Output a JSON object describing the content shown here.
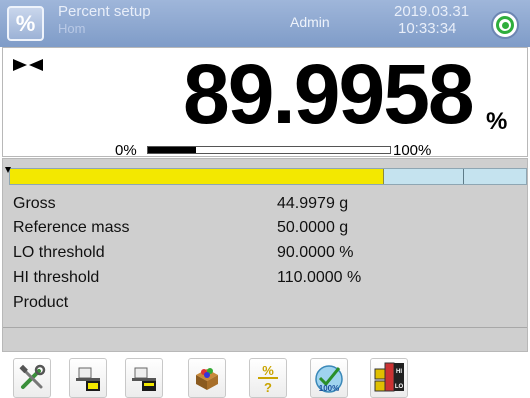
{
  "header": {
    "mode_icon": "percent-icon",
    "mode_icon_glyph": "%",
    "mode_title": "Percent setup",
    "mode_subtitle": "Hom",
    "user": "Admin",
    "date": "2019.03.31",
    "time": "10:33:34",
    "status_icon": "status-ok-icon"
  },
  "display": {
    "stability_icon": "stable-indicator-icon",
    "value": "89.9958",
    "unit": "%",
    "range_min_label": "0%",
    "range_max_label": "100%",
    "range_fill_fraction": 0.2
  },
  "threshold_bar": {
    "fill_fraction": 0.725,
    "hi_mark_fraction": 0.877
  },
  "info": {
    "rows": [
      {
        "label": "Gross",
        "value": "44.9979 g"
      },
      {
        "label": "Reference mass",
        "value": "50.0000 g"
      },
      {
        "label": "LO threshold",
        "value": "90.0000 %"
      },
      {
        "label": "HI threshold",
        "value": "110.0000 %"
      },
      {
        "label": "Product",
        "value": ""
      }
    ]
  },
  "toolbar": {
    "buttons": [
      {
        "icon": "settings-tools-icon"
      },
      {
        "icon": "tare-icon"
      },
      {
        "icon": "zero-icon"
      },
      {
        "icon": "product-database-icon"
      },
      {
        "icon": "percent-reference-icon",
        "glyph_top": "%",
        "glyph_bottom": "?"
      },
      {
        "icon": "reference-100-icon",
        "glyph": "100%"
      },
      {
        "icon": "hi-lo-thresholds-icon",
        "glyph_top": "HI",
        "glyph_bottom": "LO"
      }
    ]
  },
  "colors": {
    "header_bg": "#8ea8d2",
    "threshold_fill": "#f3e800",
    "threshold_bg": "#c5e3ef",
    "status_ok": "#2fae3c",
    "info_bg": "#cfcfcf"
  }
}
